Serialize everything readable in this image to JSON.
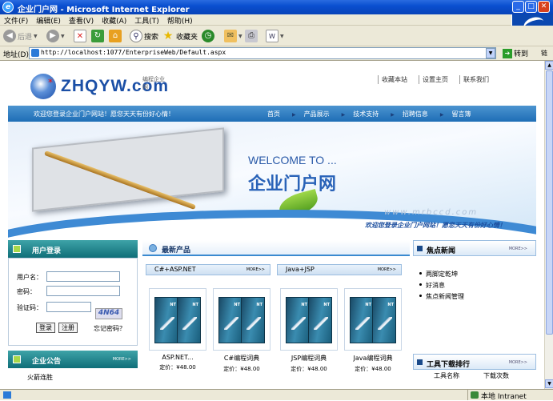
{
  "window": {
    "title": "企业门户网 - Microsoft Internet Explorer"
  },
  "menu": [
    "文件(F)",
    "编辑(E)",
    "查看(V)",
    "收藏(A)",
    "工具(T)",
    "帮助(H)"
  ],
  "toolbar": {
    "back": "后退",
    "search": "搜索",
    "favorites": "收藏夹"
  },
  "address": {
    "label": "地址(D)",
    "url": "http://localhost:1077/EnterpriseWeb/Default.aspx",
    "go": "转到",
    "links": "链"
  },
  "status": {
    "zone": "本地 Intranet"
  },
  "site": {
    "logo": "ZHQYW.com",
    "logo_prefix": "*",
    "logo_sub": "编程企业网",
    "top_links": [
      "收藏本站",
      "设置主页",
      "联系我们"
    ],
    "welcome": "欢迎您登录企业门户网站！愿您天天有份好心情！",
    "nav": [
      "首页",
      "产品展示",
      "技术支持",
      "招聘信息",
      "留言簿"
    ],
    "banner_en": "WELCOME TO ...",
    "banner_cn": "企业门户网",
    "watermark": "www.mrbccd.com",
    "banner_slogan": "欢迎您登录企业门户网站！愿您天天有份好心情！"
  },
  "login": {
    "title": "用户登录",
    "username_label": "用户名：",
    "password_label": "密码：",
    "captcha_label": "验证码：",
    "captcha": "4N64",
    "login_btn": "登录",
    "register_btn": "注册",
    "forgot": "忘记密码？"
  },
  "notice": {
    "title": "企业公告",
    "more": "MORE>>",
    "items": [
      "火箭连胜"
    ]
  },
  "products": {
    "title": "最新产品",
    "tabs": [
      {
        "label": "C#+ASP.NET",
        "more": "MORE>>"
      },
      {
        "label": "Java+JSP",
        "more": "MORE>>"
      }
    ],
    "items": [
      {
        "name": "ASP.NET...",
        "price": "定价：¥48.00"
      },
      {
        "name": "C#编程词典",
        "price": "定价：¥48.00"
      },
      {
        "name": "JSP编程词典",
        "price": "定价：¥48.00"
      },
      {
        "name": "Java编程词典",
        "price": "定价：¥48.00"
      }
    ]
  },
  "news": {
    "title": "焦点新闻",
    "more": "MORE>>",
    "items": [
      "两脚定乾坤",
      "好消息",
      "焦点新闻管理"
    ]
  },
  "downloads": {
    "title": "工具下载排行",
    "more": "MORE>>",
    "columns": [
      "工具名称",
      "下载次数"
    ]
  },
  "colors": {
    "title_bar": "#0a4fd0",
    "nav_bar": "#1e6eb6",
    "teal_head": "#0f6e78"
  }
}
